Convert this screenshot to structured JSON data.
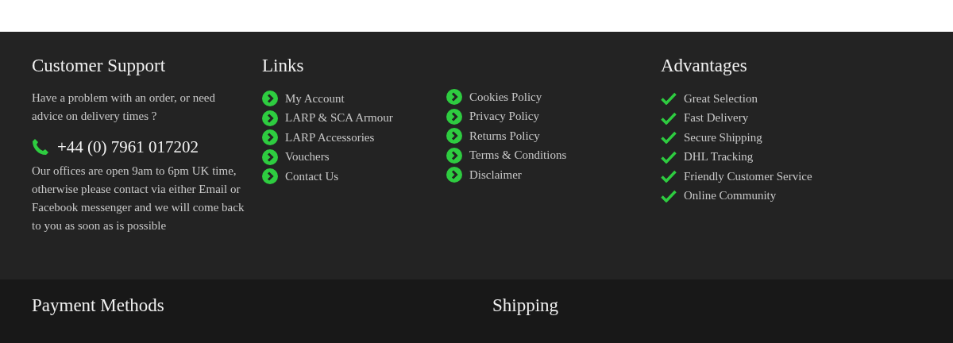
{
  "support": {
    "title": "Customer Support",
    "intro": "Have a problem with an order, or need advice on delivery times ?",
    "phone": "+44 (0) 7961 017202",
    "hours": "Our offices are open 9am to 6pm UK time, otherwise please contact via either Email or Facebook messenger and we will come back to you as soon as is possible"
  },
  "links": {
    "title": "Links",
    "columns": [
      [
        "My Account",
        "LARP & SCA Armour",
        "LARP Accessories",
        "Vouchers",
        "Contact Us"
      ],
      [
        "Cookies Policy",
        "Privacy Policy",
        "Returns Policy",
        "Terms & Conditions",
        "Disclaimer"
      ]
    ]
  },
  "advantages": {
    "title": "Advantages",
    "items": [
      "Great Selection",
      "Fast Delivery",
      "Secure Shipping",
      "DHL Tracking",
      "Friendly Customer Service",
      "Online Community"
    ]
  },
  "bottom": [
    "Payment Methods",
    "Shipping"
  ]
}
